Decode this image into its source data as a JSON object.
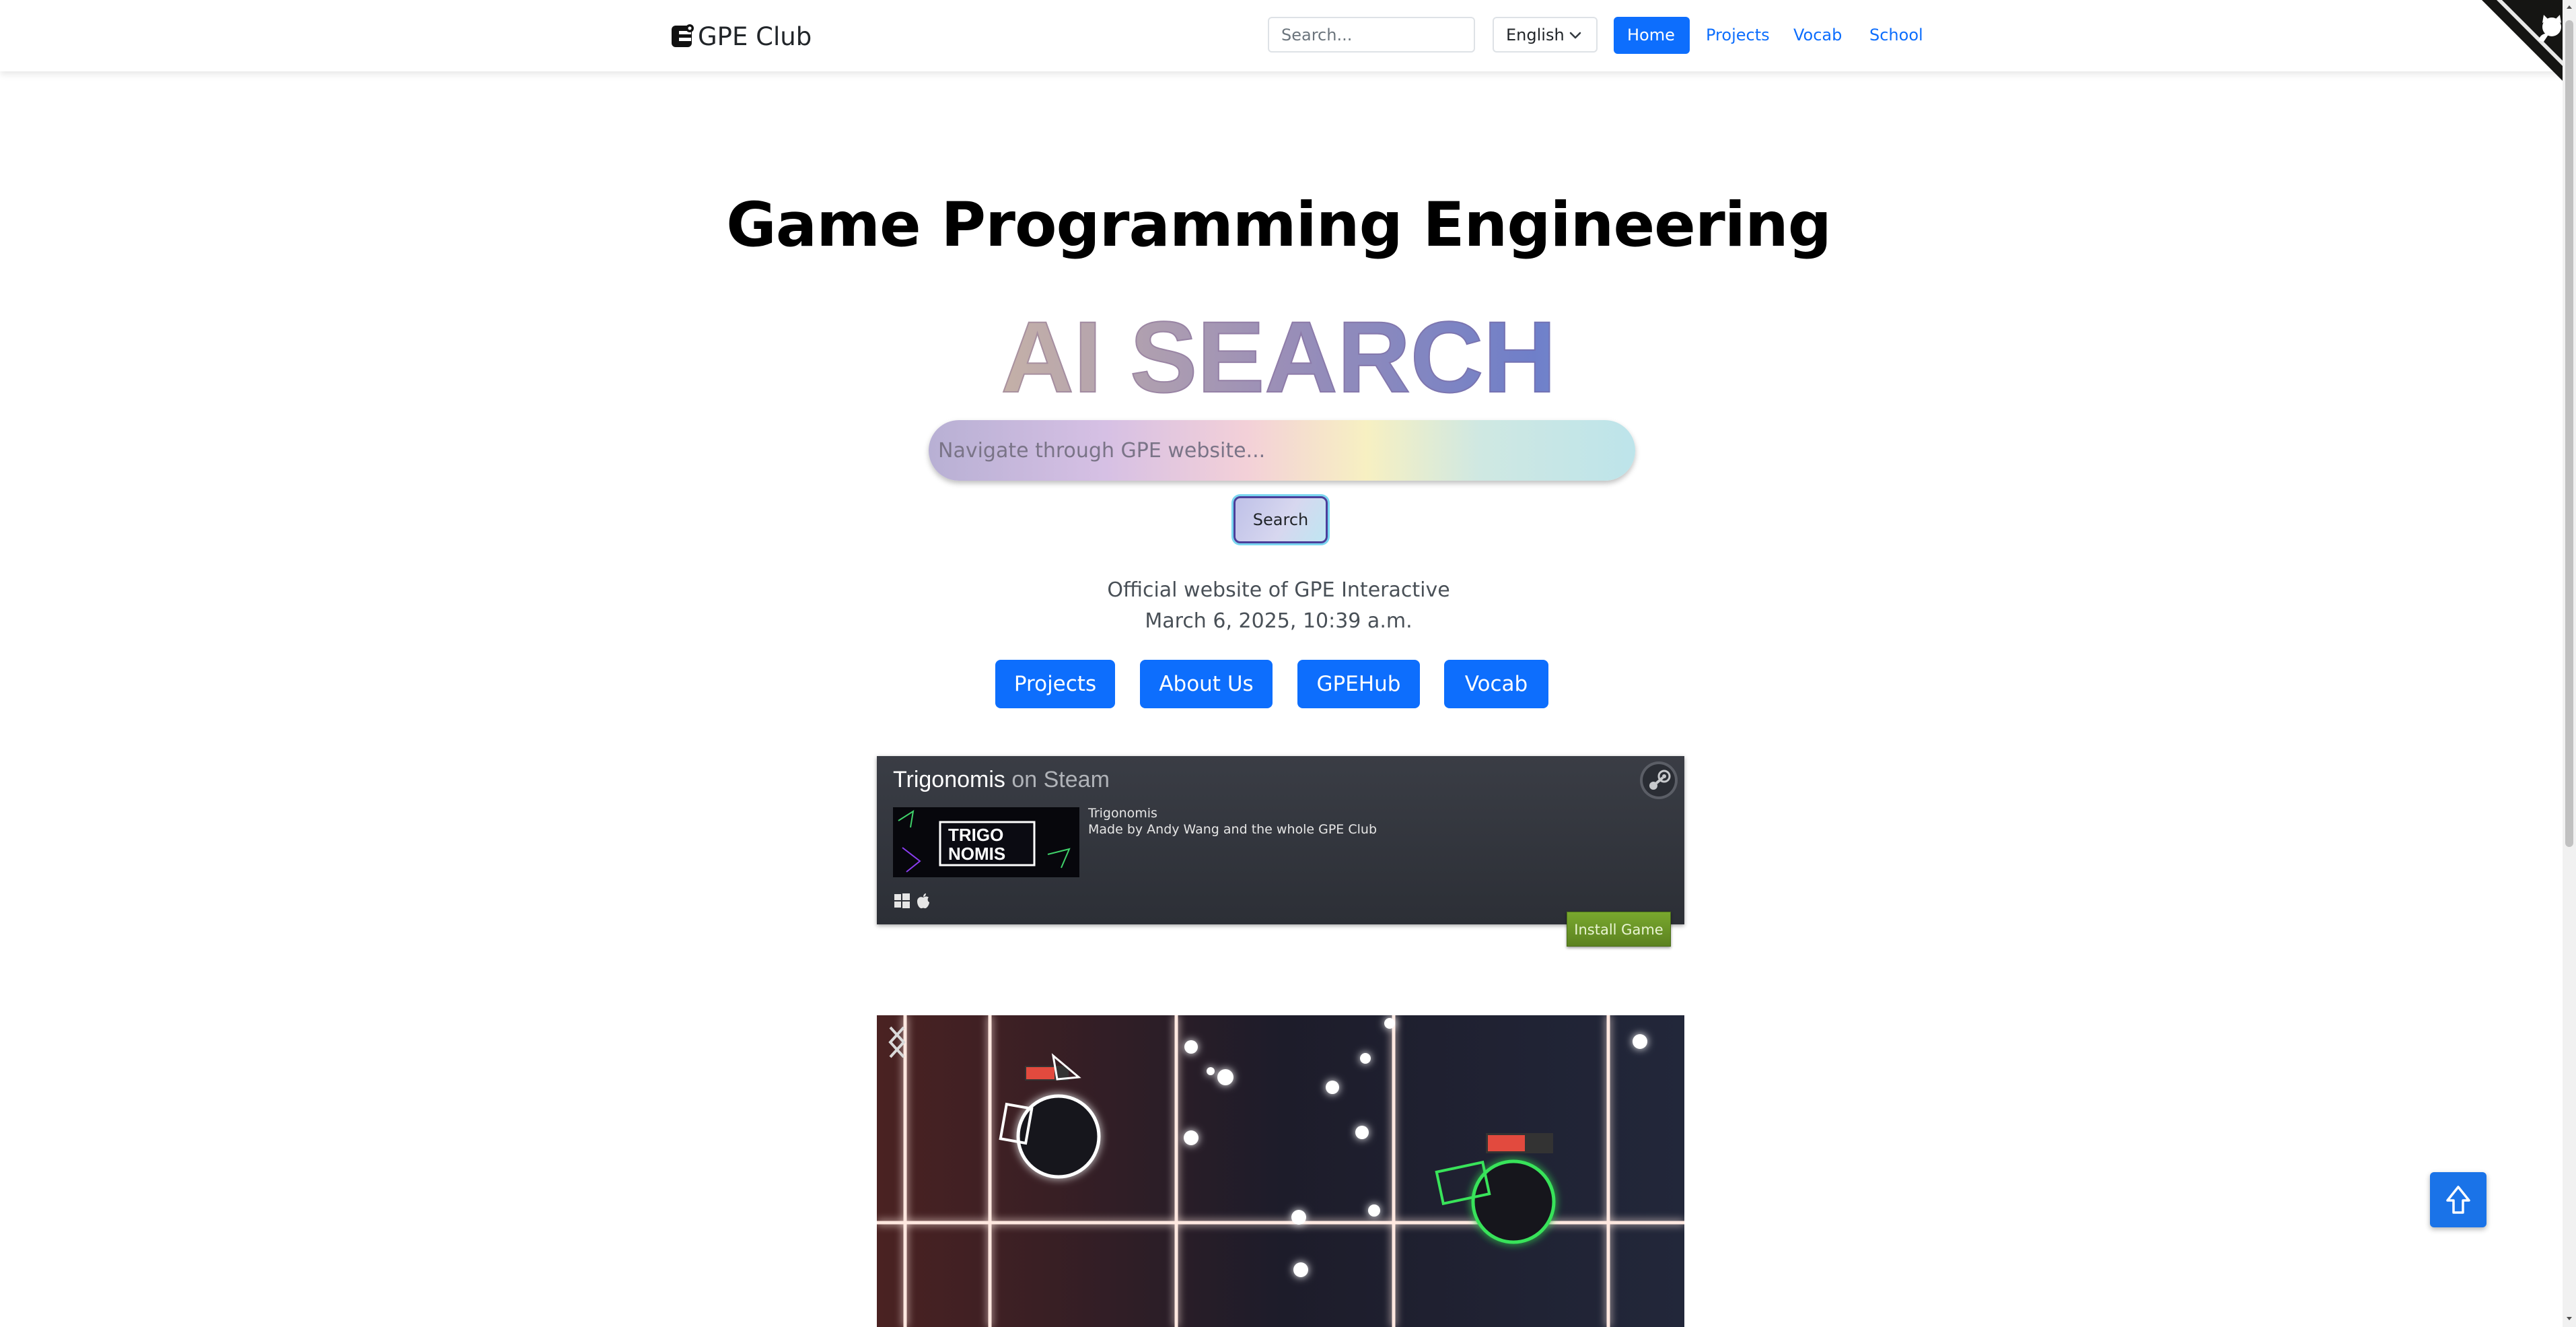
{
  "navbar": {
    "brand": "GPE Club",
    "search_placeholder": "Search...",
    "language": "English",
    "links": [
      "Home",
      "Projects",
      "Vocab",
      "School"
    ],
    "active_link": "Home"
  },
  "hero": {
    "title": "Game Programming Engineering",
    "ai_search_heading": "AI SEARCH",
    "ai_search_placeholder": "Navigate through GPE website...",
    "ai_search_button": "Search",
    "subtitle": "Official website of GPE Interactive",
    "datetime": "March 6, 2025, 10:39 a.m.",
    "buttons": [
      "Projects",
      "About Us",
      "GPEHub",
      "Vocab"
    ]
  },
  "steam_widget": {
    "game_title": "Trigonomis",
    "on_steam": "on Steam",
    "game_name": "Trigonomis",
    "description": "Made by Andy Wang and the whole GPE Club",
    "install_label": "Install Game",
    "capsule_text_line1": "TRIGO",
    "capsule_text_line2": "NOMIS",
    "platforms": [
      "windows-icon",
      "apple-icon"
    ]
  },
  "colors": {
    "primary": "#0d6efd",
    "steam_bg": "#2c2f36",
    "install_green": "#6a9627"
  },
  "icons": {
    "brand": "gpe-logo-icon",
    "corner": "github-octocat-corner-icon",
    "steam": "steam-logo-icon",
    "prev": "chevron-left-icon",
    "next": "chevron-right-icon",
    "back_to_top": "arrow-up-icon"
  }
}
